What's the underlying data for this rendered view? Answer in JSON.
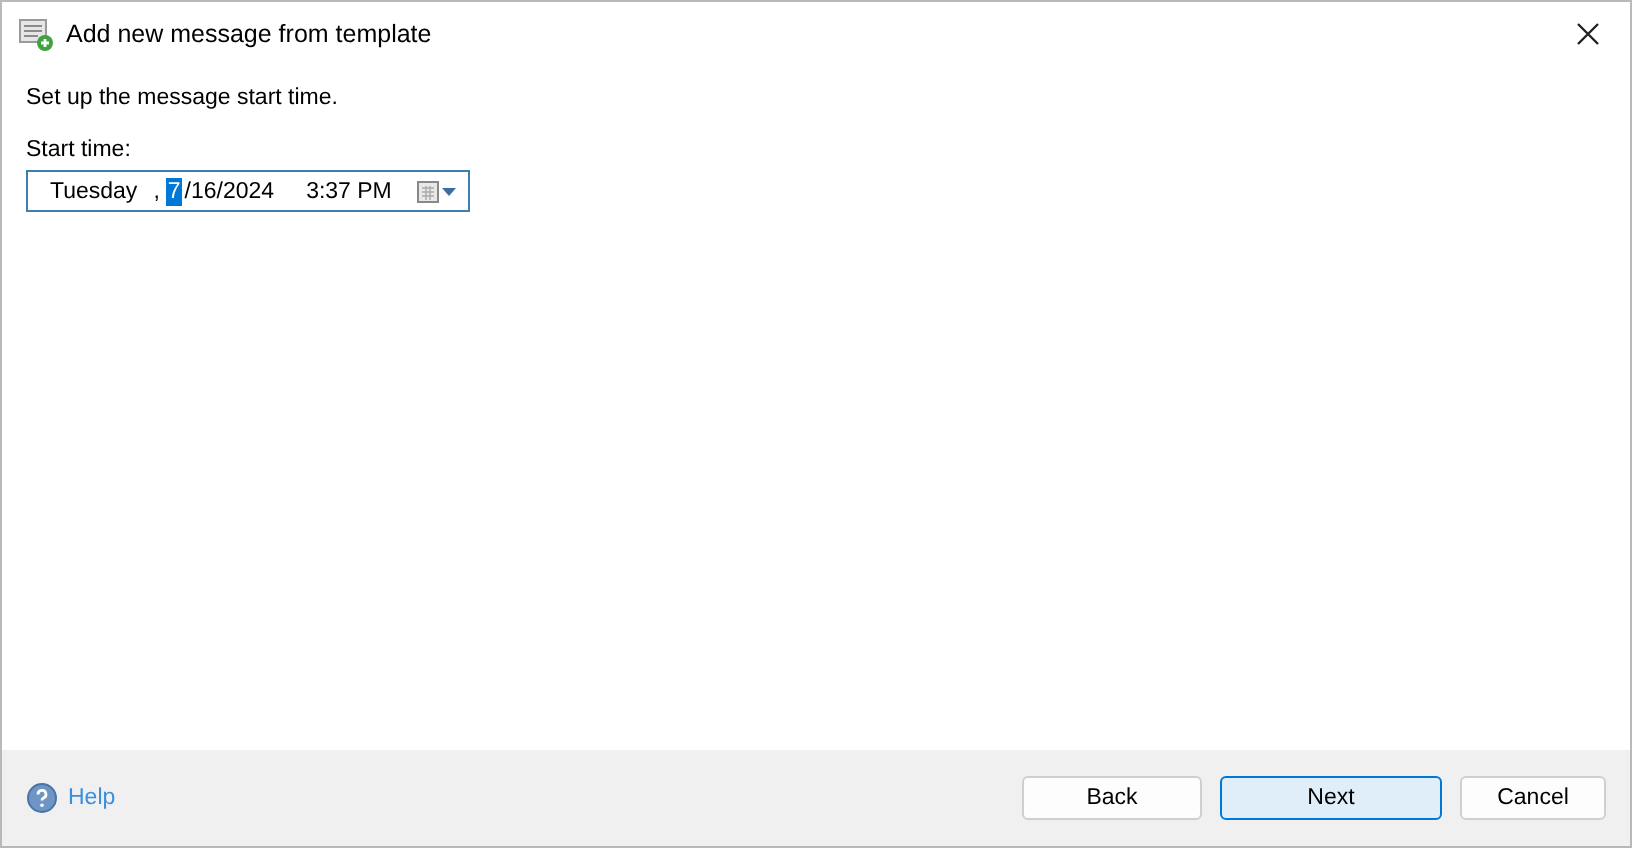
{
  "window": {
    "title": "Add new message from template"
  },
  "instruction": "Set up the message start time.",
  "start_time": {
    "label": "Start time:",
    "segments": [
      {
        "text": "Tuesday",
        "selected": false
      },
      {
        "text": ",",
        "selected": false
      },
      {
        "text": "7",
        "selected": true
      },
      {
        "text": "/16/2024",
        "selected": false
      },
      {
        "text": "3:37 PM",
        "selected": false
      }
    ]
  },
  "footer": {
    "help": "Help",
    "buttons": [
      {
        "label": "Back",
        "default": false
      },
      {
        "label": "Next",
        "default": true
      },
      {
        "label": "Cancel",
        "default": false
      }
    ]
  }
}
